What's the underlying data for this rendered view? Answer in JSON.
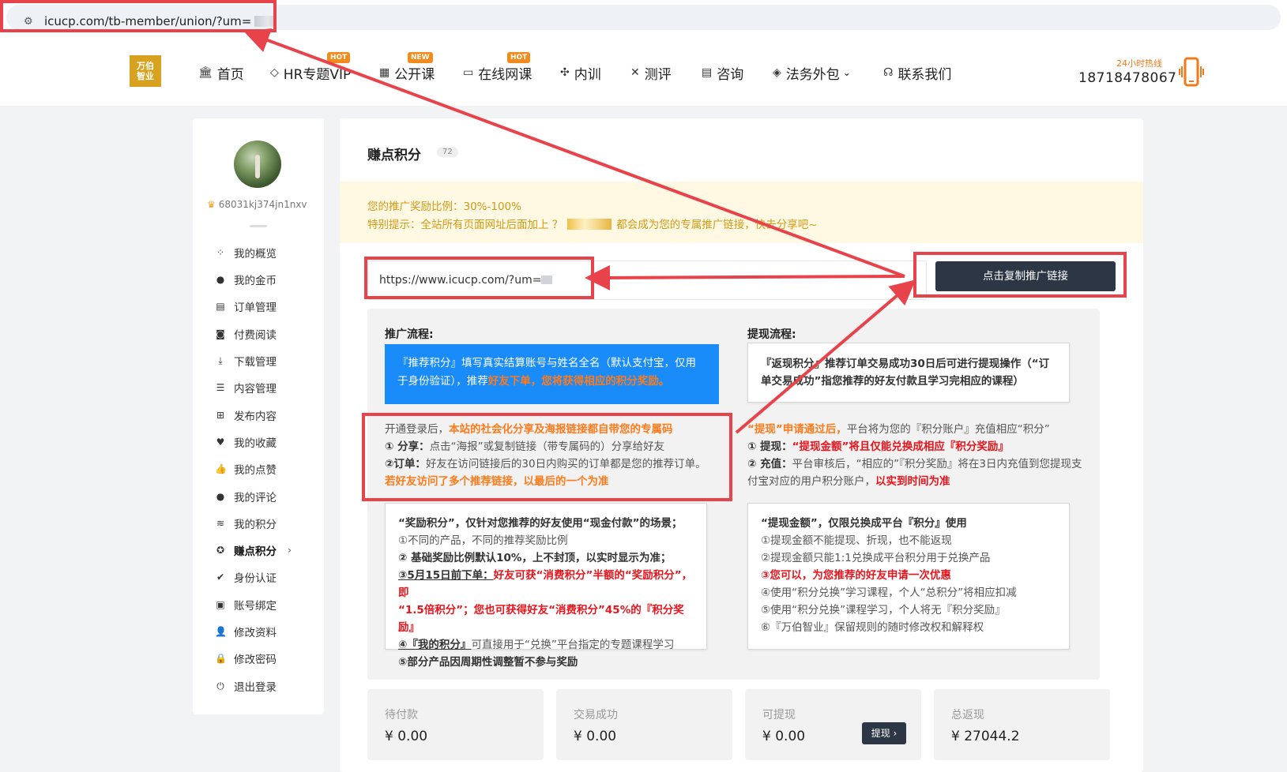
{
  "browser": {
    "url": "icucp.com/tb-member/union/?um="
  },
  "header": {
    "logo_text": "万伯\n智业",
    "nav": [
      {
        "label": "首页",
        "icon": "bank-icon"
      },
      {
        "label": "HR专题VIP",
        "icon": "diamond-icon",
        "badge": "HOT"
      },
      {
        "label": "公开课",
        "icon": "grid-icon",
        "badge": "NEW"
      },
      {
        "label": "在线网课",
        "icon": "monitor-icon",
        "badge": "HOT"
      },
      {
        "label": "内训",
        "icon": "puzzle-icon"
      },
      {
        "label": "测评",
        "icon": "tools-icon"
      },
      {
        "label": "咨询",
        "icon": "ticket-icon"
      },
      {
        "label": "法务外包",
        "icon": "tag-icon",
        "has_dropdown": true
      },
      {
        "label": "联系我们",
        "icon": "headset-icon"
      }
    ],
    "hotline_label": "24小时热线",
    "hotline_number": "18718478067"
  },
  "sidebar": {
    "username": "68031kj374jn1nxv",
    "items": [
      {
        "label": "我的概览",
        "icon": "grid-icon"
      },
      {
        "label": "我的金币",
        "icon": "coin-icon"
      },
      {
        "label": "订单管理",
        "icon": "clipboard-icon"
      },
      {
        "label": "付费阅读",
        "icon": "book-icon"
      },
      {
        "label": "下载管理",
        "icon": "download-icon"
      },
      {
        "label": "内容管理",
        "icon": "document-icon"
      },
      {
        "label": "发布内容",
        "icon": "plus-square-icon"
      },
      {
        "label": "我的收藏",
        "icon": "heart-icon"
      },
      {
        "label": "我的点赞",
        "icon": "thumbs-up-icon"
      },
      {
        "label": "我的评论",
        "icon": "comment-icon"
      },
      {
        "label": "我的积分",
        "icon": "coins-stack-icon"
      },
      {
        "label": "赚点积分",
        "icon": "earn-icon",
        "active": true
      },
      {
        "label": "身份认证",
        "icon": "badge-check-icon"
      },
      {
        "label": "账号绑定",
        "icon": "id-card-icon"
      },
      {
        "label": "修改资料",
        "icon": "user-icon"
      },
      {
        "label": "修改密码",
        "icon": "lock-icon"
      },
      {
        "label": "退出登录",
        "icon": "power-icon"
      }
    ]
  },
  "main": {
    "title": "赚点积分",
    "count": "72",
    "notice_line1": "您的推广奖励比例：30%-100%",
    "notice_line2_a": "特别提示：全站所有页面网址后面加上 ？",
    "notice_line2_b": "都会成为您的专属推广链接，快去分享吧~",
    "link_value": "https://www.icucp.com/?um=",
    "copy_button": "点击复制推广链接",
    "promo": {
      "title": "推广流程:",
      "blue_a": "『推荐积分』填写真实结算账号与姓名全名（默认支付宝，仅用于身份验证），推荐",
      "blue_b": "好友下单，您将获得相应的积分奖励。",
      "p1_a": "开通登录后，",
      "p1_b": "本站的社会化分享及海报链接都自带您的专属码",
      "p2_a": "① 分享：",
      "p2_b": "点击“海报”或复制链接（带专属码的）分享给好友",
      "p3_a": "②订单：",
      "p3_b": "好友在访问链接后的30日内购买的订单都是您的推荐订单。",
      "p4": "若好友访问了多个推荐链接，以最后的一个为准",
      "box_lines": [
        "“奖励积分”，仅针对您推荐的好友使用“现金付款”的场景；",
        "①不同的产品，不同的推荐奖励比例",
        "② 基础奖励比例默认10%，上不封顶，以实时显示为准；"
      ],
      "box_l4_a": "③5月15日前下单：",
      "box_l4_b": "好友可获“消费积分”半额的“奖励积分”，即",
      "box_l5": "“1.5倍积分”；您也可获得好友“消费积分”45%的『积分奖励』",
      "box_l6_a": "④『我的积分』",
      "box_l6_b": "可直接用于“兑换”平台指定的专题课程学习",
      "box_l7": "⑤部分产品因周期性调整暂不参与奖励"
    },
    "withdraw": {
      "title": "提现流程:",
      "box1": "『返现积分』推荐订单交易成功30日后可进行提现操作（“订单交易成功”指您推荐的好友付款且学习完相应的课程）",
      "p1_a": "“提现”申请通过后，",
      "p1_b": "平台将为您的『积分账户』充值相应“积分”",
      "p2_a": "① 提现：",
      "p2_b": "“提现金额”将且仅能兑换成相应『积分奖励』",
      "p3_a": "② 充值：",
      "p3_b": "平台审核后，“相应的”『积分奖励』将在3日内充值到您提现支付宝对应的用户积分账户，",
      "p3_c": "以实到时间为准",
      "box_lines": [
        "“提现金额”，仅限兑换成平台『积分』使用",
        "①提现金额不能提现、折现，也不能返现",
        "②提现金额只能1:1兑换成平台积分用于兑换产品"
      ],
      "box_l4": "③您可以，为您推荐的好友申请一次优惠",
      "box_l5": "④使用“积分兑换”学习课程，个人“总积分”将相应扣减",
      "box_l6": "⑤使用“积分兑换”课程学习，个人将无『积分奖励』",
      "box_l7": "⑥『万伯智业』保留规则的随时修改权和解释权"
    },
    "stats": [
      {
        "label": "待付款",
        "value": "¥ 0.00"
      },
      {
        "label": "交易成功",
        "value": "¥ 0.00"
      },
      {
        "label": "可提现",
        "value": "¥ 0.00",
        "button": "提现 ›"
      },
      {
        "label": "总返现",
        "value": "¥ 27044.2"
      }
    ]
  },
  "colors": {
    "annotation_red": "#e8434a",
    "accent_dark": "#2c3645",
    "blue": "#1a8cfa",
    "gold": "#d6a21f"
  }
}
